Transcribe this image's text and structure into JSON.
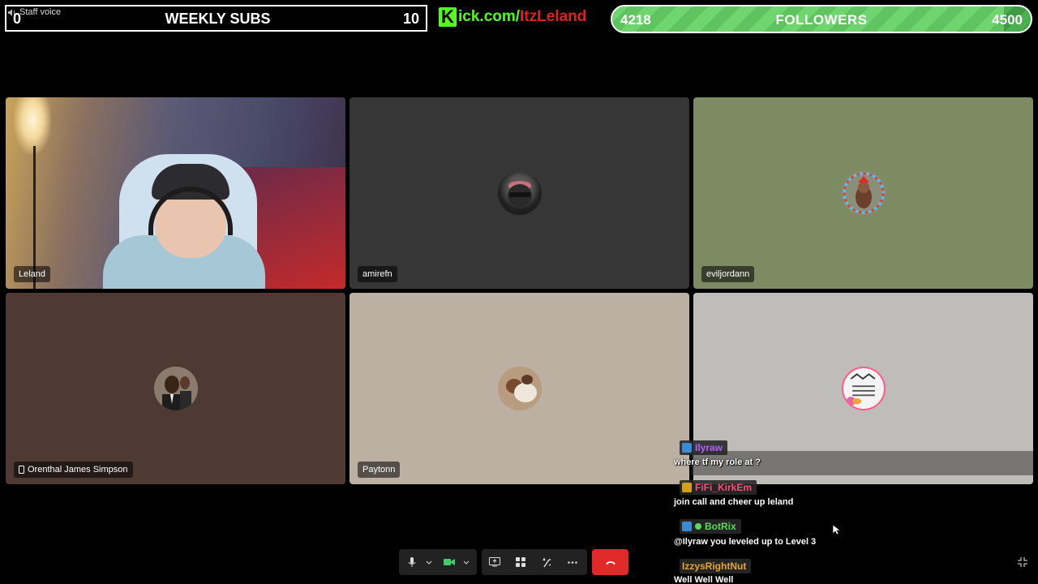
{
  "overlay": {
    "staff_voice": "Staff voice",
    "weekly_subs": {
      "current": "0",
      "title": "WEEKLY SUBS",
      "goal": "10"
    },
    "kick": {
      "logo": "K",
      "url_green": "ick.com/",
      "url_red": "ItzLeland"
    },
    "followers": {
      "current": "4218",
      "title": "FOLLOWERS",
      "goal": "4500",
      "progress": 0.936
    }
  },
  "tiles": [
    {
      "name": "Leland",
      "active": true,
      "bg": "#3a3a4a"
    },
    {
      "name": "amirefn",
      "bg": "#363636"
    },
    {
      "name": "eviljordann",
      "bg": "#7d8b62"
    },
    {
      "name": "Orenthal James Simpson",
      "bg": "#4e3a33",
      "mobile_icon": "phone-icon"
    },
    {
      "name": "Paytonn",
      "bg": "#bcb0a2"
    },
    {
      "name": "",
      "bg": "#bfbdba"
    }
  ],
  "chat": [
    {
      "user": "Ilyraw",
      "color": "#b15cff",
      "badge_color": "#3a8bd6",
      "message": "where tf my role at ?"
    },
    {
      "user": "FiFi_KirkEm",
      "color": "#ff4d7a",
      "badge_color": "#d4a017",
      "message": "join call and cheer up leland"
    },
    {
      "user": "BotRix",
      "color": "#5cd65c",
      "badge_color": "#3a8bd6",
      "message": "@Ilyraw you leveled up to Level 3"
    },
    {
      "user": "IzzysRightNut",
      "color": "#e5a630",
      "badge_color": "",
      "message": "Well Well Well"
    }
  ],
  "controls": {
    "mic": "mic-icon",
    "camera": "camera-icon",
    "share": "share-screen-icon",
    "apps": "apps-icon",
    "effects": "effects-icon",
    "more": "more-icon",
    "hangup": "hangup-icon"
  }
}
